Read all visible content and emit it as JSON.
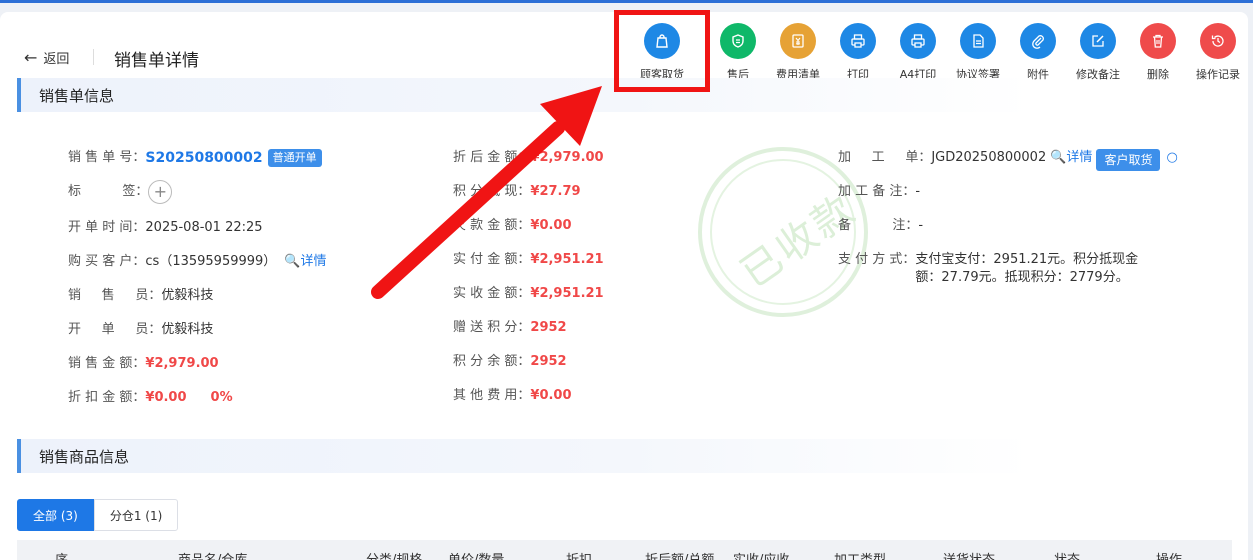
{
  "header": {
    "back_label": "返回",
    "title": "销售单详情"
  },
  "toolbar": [
    {
      "label": "顾客取货",
      "color": "#1e88e5",
      "icon": "bag-icon"
    },
    {
      "label": "售后",
      "color": "#0fb869",
      "icon": "shield-icon"
    },
    {
      "label": "费用清单",
      "color": "#e6a235",
      "icon": "yen-receipt-icon"
    },
    {
      "label": "打印",
      "color": "#1e88e5",
      "icon": "printer-icon"
    },
    {
      "label": "A4打印",
      "color": "#1e88e5",
      "icon": "printer-icon"
    },
    {
      "label": "协议签署",
      "color": "#1e88e5",
      "icon": "document-icon"
    },
    {
      "label": "附件",
      "color": "#1e88e5",
      "icon": "paperclip-icon"
    },
    {
      "label": "修改备注",
      "color": "#1e88e5",
      "icon": "edit-icon"
    },
    {
      "label": "删除",
      "color": "#ef4b4b",
      "icon": "trash-icon"
    },
    {
      "label": "操作记录",
      "color": "#ef4b4b",
      "icon": "history-icon"
    }
  ],
  "sections": {
    "order_info": "销售单信息",
    "product_info": "销售商品信息"
  },
  "col1": {
    "order_no_label": "销 售 单 号：",
    "order_no": "S20250800002",
    "order_tag": "普通开单",
    "tag_label": "标          签：",
    "time_label": "开 单 时 间：",
    "time": "2025-08-01 22:25",
    "customer_label": "购 买 客 户：",
    "customer": "cs（13595959999）",
    "customer_detail": "详情",
    "seller_label": "销     售     员：",
    "seller": "优毅科技",
    "creator_label": "开     单     员：",
    "creator": "优毅科技",
    "amount_label": "销 售 金 额：",
    "amount": "¥2,979.00",
    "discount_label": "折 扣 金 额：",
    "discount": "¥0.00",
    "discount_pct": "0%"
  },
  "col2": {
    "after_discount_label": "折 后 金 额：",
    "after_discount": "¥2,979.00",
    "points_cash_label": "积 分 抵 现：",
    "points_cash": "¥27.79",
    "refund_label": "欠 款 金 额：",
    "refund": "¥0.00",
    "paid_label": "实 付 金 额：",
    "paid": "¥2,951.21",
    "received_label": "实 收 金 额：",
    "received": "¥2,951.21",
    "gift_points_label": "赠 送 积 分：",
    "gift_points": "2952",
    "points_balance_label": "积 分 余 额：",
    "points_balance": "2952",
    "other_fee_label": "其 他 费 用：",
    "other_fee": "¥0.00"
  },
  "col3": {
    "process_label": "加     工     单：",
    "process_no": "JGD20250800002",
    "process_detail": "详情",
    "pickup_btn": "客户取货",
    "process_note_label": "加 工 备 注：",
    "process_note": "-",
    "note_label": "备          注：",
    "note": "-",
    "pay_label": "支 付 方 式：",
    "pay_line1": "支付宝支付：2951.21元。积分抵现金",
    "pay_line2": "额：27.79元。抵现积分：2779分。"
  },
  "stamp": "已收款",
  "tabs": [
    {
      "label": "全部 (3)",
      "active": true
    },
    {
      "label": "分仓1 (1)",
      "active": false
    }
  ],
  "table_headers": [
    "序",
    "商品名/仓库",
    "分类/规格",
    "单价/数量",
    "折扣",
    "折后额/总额",
    "实收/应收",
    "加工类型",
    "送货状态",
    "状态",
    "操作"
  ]
}
